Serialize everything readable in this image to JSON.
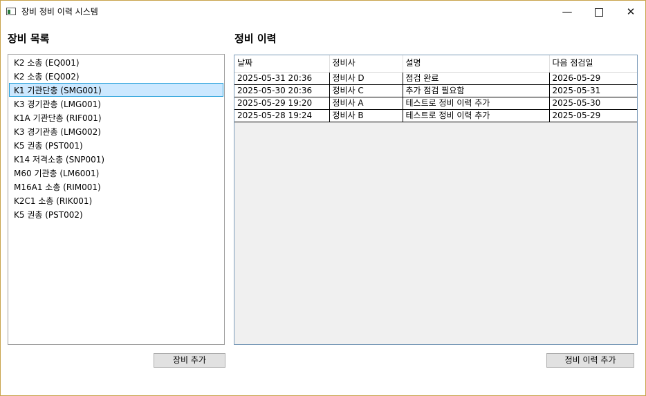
{
  "window": {
    "title": "장비 정비 이력 시스템",
    "minimize": "—",
    "close": "✕"
  },
  "equipment": {
    "header": "장비 목록",
    "items": [
      "K2 소총 (EQ001)",
      "K2 소총 (EQ002)",
      "K1 기관단총 (SMG001)",
      "K3 경기관총 (LMG001)",
      "K1A 기관단총 (RIF001)",
      "K3 경기관총 (LMG002)",
      "K5 권총 (PST001)",
      "K14 저격소총 (SNP001)",
      "M60 기관총 (LM6001)",
      "M16A1 소총 (RIM001)",
      "K2C1 소총 (RIK001)",
      "K5 권총 (PST002)"
    ],
    "selected_index": 2,
    "add_button": "장비 추가"
  },
  "maintenance": {
    "header": "정비 이력",
    "columns": [
      "날짜",
      "정비사",
      "설명",
      "다음 점검일"
    ],
    "rows": [
      [
        "2025-05-31 20:36",
        "정비사 D",
        "점검 완료",
        "2026-05-29"
      ],
      [
        "2025-05-30 20:36",
        "정비사 C",
        "추가 점검 필요함",
        "2025-05-31"
      ],
      [
        "2025-05-29 19:20",
        "정비사 A",
        "테스트로 정비 이력 추가",
        "2025-05-30"
      ],
      [
        "2025-05-28 19:24",
        "정비사 B",
        "테스트로 정비 이력 추가",
        "2025-05-29"
      ]
    ],
    "add_button": "정비 이력 추가"
  }
}
